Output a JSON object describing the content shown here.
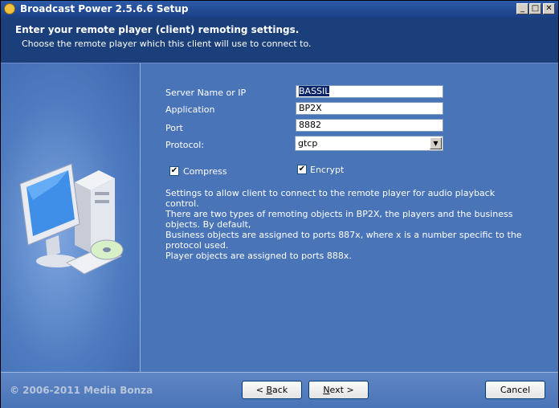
{
  "window": {
    "title": "Broadcast Power 2.5.6.6 Setup",
    "controls": {
      "minimize": "_",
      "maximize": "□",
      "close": "✕"
    }
  },
  "header": {
    "title": "Enter your remote player (client) remoting settings.",
    "subtitle": "Choose the remote player which this client will use to connect to."
  },
  "form": {
    "server_label": "Server Name or IP",
    "server_value": "BASSIL",
    "application_label": "Application",
    "application_value": "BP2X",
    "port_label": "Port",
    "port_value": "8882",
    "protocol_label": "Protocol:",
    "protocol_value": "gtcp",
    "compress_label": "Compress",
    "compress_checked": true,
    "encrypt_label": "Encrypt",
    "encrypt_checked": true
  },
  "info": {
    "line1": "Settings to allow client to connect to the remote player for audio playback control.",
    "line2": "There are two types of remoting objects in BP2X, the players and the business objects. By default,",
    "line3": "Business objects are assigned to ports 887x, where x is a number specific to the protocol used.",
    "line4": "Player objects are assigned to ports 888x."
  },
  "footer": {
    "copyright": "© 2006-2011 Media Bonza",
    "back_prefix": "< ",
    "back_hotkey": "B",
    "back_rest": "ack",
    "next_hotkey": "N",
    "next_rest": "ext >",
    "cancel_label": "Cancel"
  }
}
